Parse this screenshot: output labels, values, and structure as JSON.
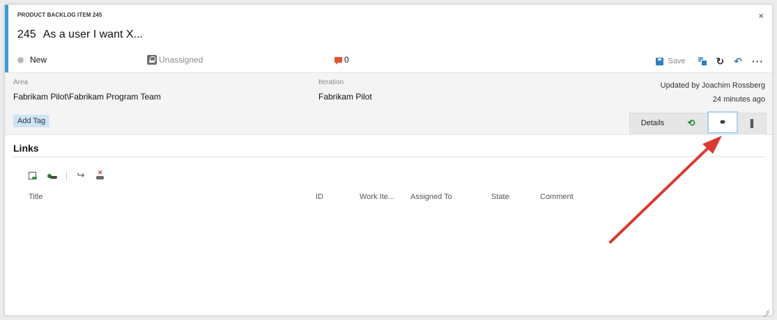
{
  "header": {
    "type_label": "PRODUCT BACKLOG ITEM 245",
    "id": "245",
    "title": "As a user I want X...",
    "close": "×"
  },
  "status": {
    "state": "New",
    "assigned": "Unassigned",
    "comment_count": "0"
  },
  "toolbar": {
    "save_label": "Save",
    "refresh": "↻",
    "undo": "↶",
    "more": "···"
  },
  "fields": {
    "area_label": "Area",
    "area_value": "Fabrikam Pilot\\Fabrikam Program Team",
    "iteration_label": "Iteration",
    "iteration_value": "Fabrikam Pilot",
    "updated_by": "Updated by Joachim Rossberg",
    "updated_when": "24 minutes ago",
    "add_tag": "Add Tag"
  },
  "tabs": {
    "details": "Details",
    "history": "⟲",
    "links": "⚭",
    "attachments": "❚"
  },
  "links": {
    "title": "Links",
    "open_glyph": "↪",
    "columns": [
      "Title",
      "ID",
      "Work Ite...",
      "Assigned To",
      "State",
      "Comment"
    ]
  },
  "colors": {
    "accent": "#3f9bd4",
    "comment_icon": "#e2522c",
    "annotation_arrow": "#d93a30",
    "tab_highlight": "#a9d1f2"
  }
}
